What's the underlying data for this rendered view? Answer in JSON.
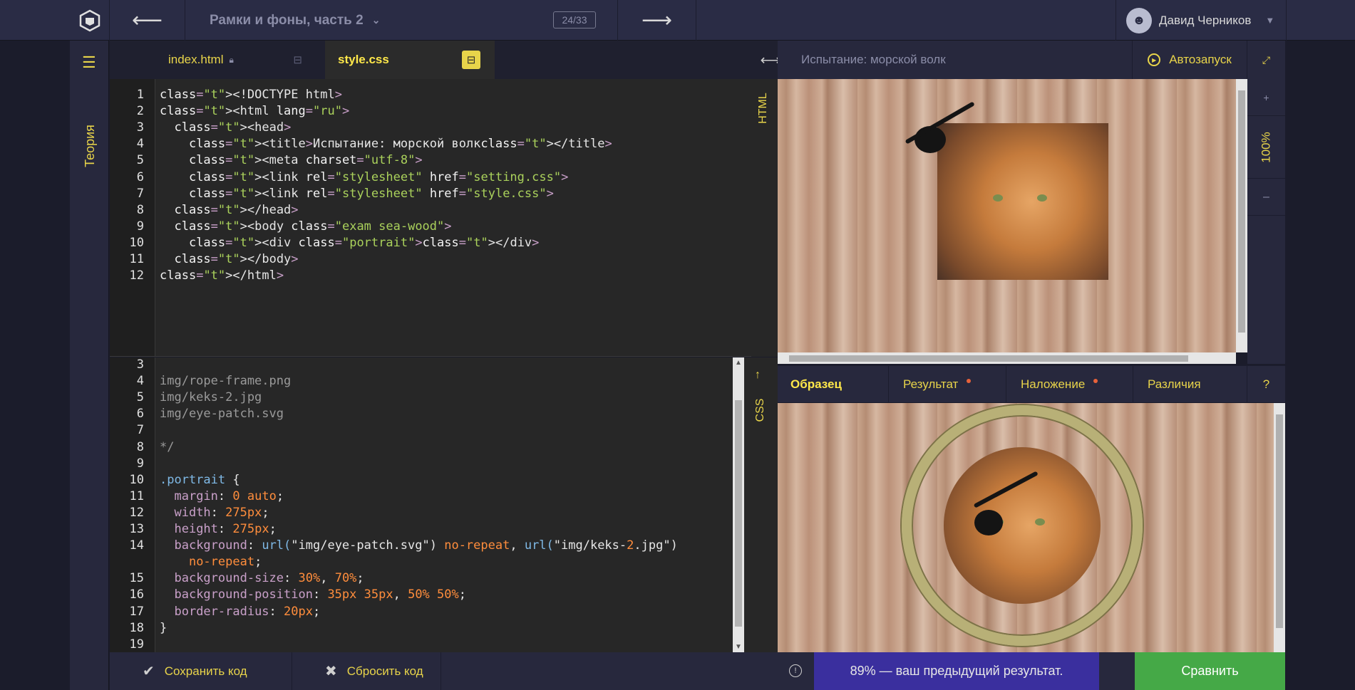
{
  "topbar": {
    "lesson_title": "Рамки и фоны, часть 2",
    "counter": "24/33",
    "prev_arrow": "⟵",
    "next_arrow": "⟶",
    "user_name": "Давид Черников"
  },
  "sidebar": {
    "theory_label": "Теория"
  },
  "tabs": [
    {
      "label": "index.html"
    },
    {
      "label": "style.css"
    }
  ],
  "html_code": [
    "<!DOCTYPE html>",
    "<html lang=\"ru\">",
    "  <head>",
    "    <title>Испытание: морской волк</title>",
    "    <meta charset=\"utf-8\">",
    "    <link rel=\"stylesheet\" href=\"setting.css\">",
    "    <link rel=\"stylesheet\" href=\"style.css\">",
    "  </head>",
    "  <body class=\"exam sea-wood\">",
    "    <div class=\"portrait\"></div>",
    "  </body>",
    "</html>"
  ],
  "html_line_numbers": [
    "1",
    "2",
    "3",
    "4",
    "5",
    "6",
    "7",
    "8",
    "9",
    "10",
    "11",
    "12"
  ],
  "css_code": [
    "",
    "img/rope-frame.png",
    "img/keks-2.jpg",
    "img/eye-patch.svg",
    "",
    "*/",
    "",
    ".portrait {",
    "  margin: 0 auto;",
    "  width: 275px;",
    "  height: 275px;",
    "  background: url(\"img/eye-patch.svg\") no-repeat, url(\"img/keks-2.jpg\")",
    "    no-repeat;",
    "  background-size: 30%, 70%;",
    "  background-position: 35px 35px, 50% 50%;",
    "  border-radius: 20px;",
    "}",
    ""
  ],
  "css_line_numbers": [
    "3",
    "4",
    "5",
    "6",
    "7",
    "8",
    "9",
    "10",
    "11",
    "12",
    "13",
    "14",
    "",
    "15",
    "16",
    "17",
    "18",
    "19"
  ],
  "pane_labels": {
    "html": "HTML",
    "css": "CSS"
  },
  "bottom_left": {
    "save": "Сохранить код",
    "reset": "Сбросить код"
  },
  "preview": {
    "title": "Испытание: морской волк",
    "autorun": "Автозапуск",
    "zoom": "100%",
    "zoom_plus": "+",
    "zoom_minus": "–"
  },
  "compare_tabs": {
    "sample": "Образец",
    "result": "Результат",
    "overlay": "Наложение",
    "diff": "Различия",
    "help": "?"
  },
  "bottom_right": {
    "prev_result": "89% — ваш предыдущий результат.",
    "compare": "Сравнить"
  },
  "colors": {
    "accent": "#e8d44a",
    "compare": "#45a947",
    "result_bar": "#3a2f9e",
    "dot": "#e8623a"
  }
}
